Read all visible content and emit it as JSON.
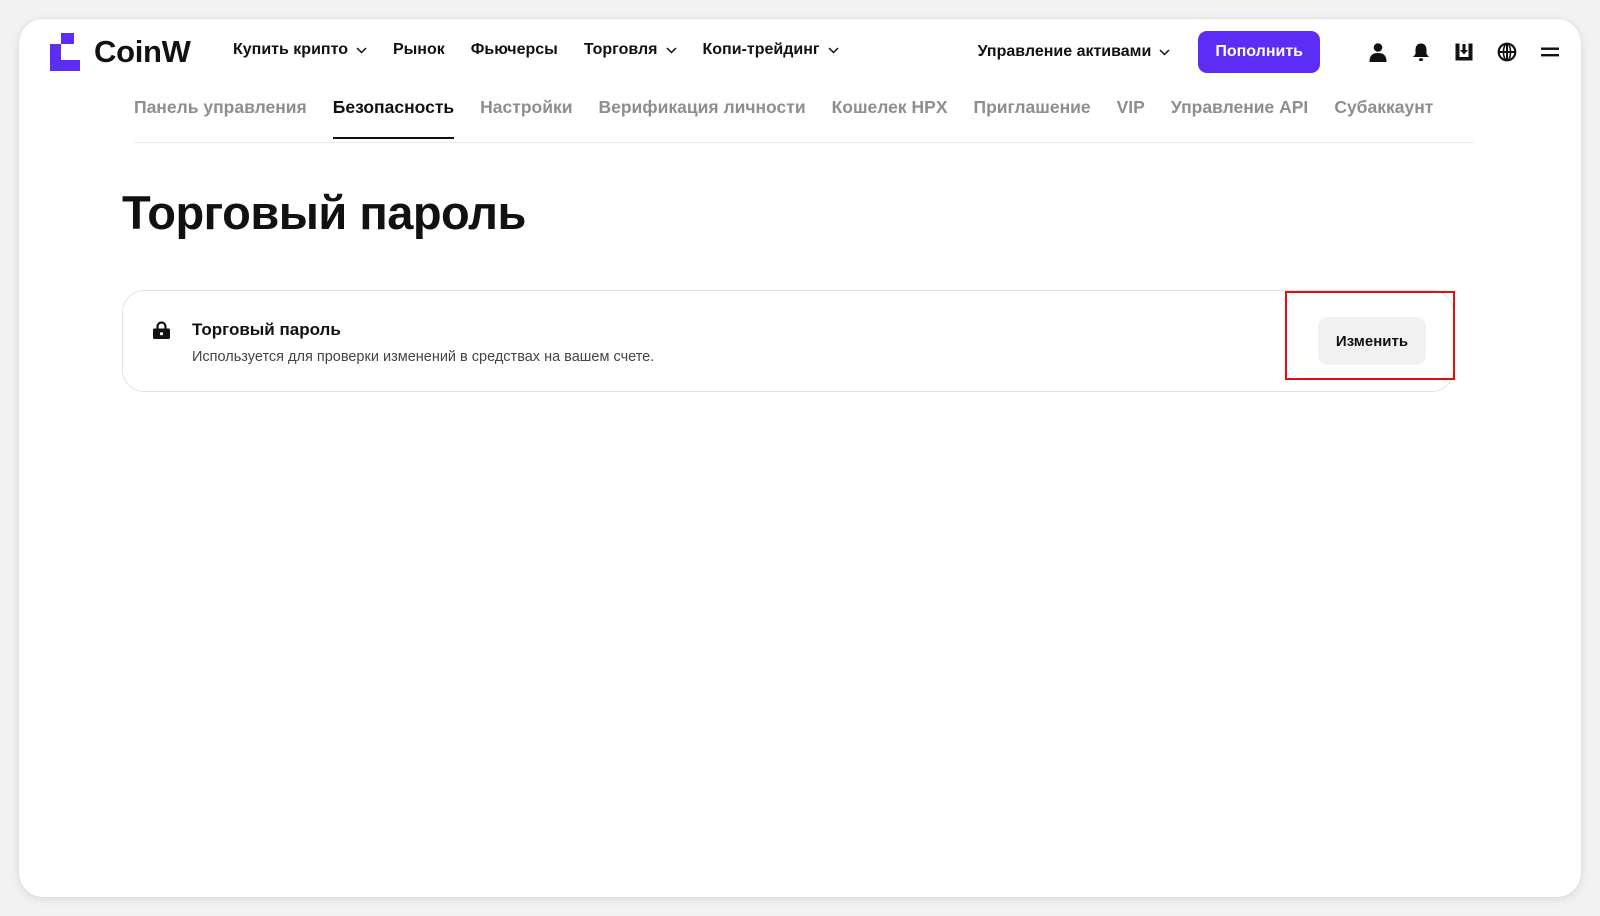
{
  "brand": {
    "name": "CoinW",
    "accent_color": "#5b2df5"
  },
  "header": {
    "nav": [
      {
        "label": "Купить крипто",
        "has_dropdown": true
      },
      {
        "label": "Рынок",
        "has_dropdown": false
      },
      {
        "label": "Фьючерсы",
        "has_dropdown": false
      },
      {
        "label": "Торговля",
        "has_dropdown": true
      },
      {
        "label": "Копи-трейдинг",
        "has_dropdown": true
      }
    ],
    "assets_menu_label": "Управление активами",
    "deposit_label": "Пополнить",
    "icons": [
      "user-icon",
      "bell-icon",
      "download-icon",
      "globe-icon",
      "menu-icon"
    ]
  },
  "tabs": [
    {
      "label": "Панель управления",
      "active": false
    },
    {
      "label": "Безопасность",
      "active": true
    },
    {
      "label": "Настройки",
      "active": false
    },
    {
      "label": "Верификация личности",
      "active": false
    },
    {
      "label": "Кошелек HPX",
      "active": false
    },
    {
      "label": "Приглашение",
      "active": false
    },
    {
      "label": "VIP",
      "active": false
    },
    {
      "label": "Управление API",
      "active": false
    },
    {
      "label": "Субаккаунт",
      "active": false
    }
  ],
  "page": {
    "title": "Торговый пароль"
  },
  "card": {
    "icon": "lock-icon",
    "title": "Торговый пароль",
    "description": "Используется для проверки изменений в средствах на вашем счете.",
    "action_label": "Изменить",
    "highlight_color": "#e01010"
  }
}
